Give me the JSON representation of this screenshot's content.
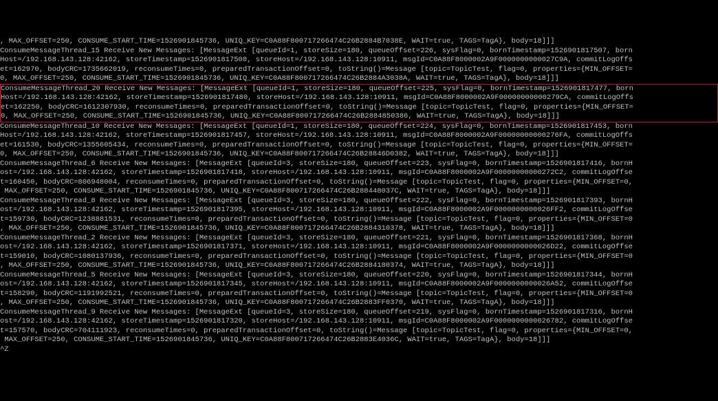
{
  "lines": {
    "l0": ", MAX_OFFSET=250, CONSUME_START_TIME=1526901845736, UNIQ_KEY=C0A88F800717266474C26B2884B7038E, WAIT=true, TAGS=TagA}, body=18]]]",
    "l1": "ConsumeMessageThread_15 Receive New Messages: [MessageExt [queueId=1, storeSize=180, queueOffset=226, sysFlag=0, bornTimestamp=1526901817507, born",
    "l2": "Host=/192.168.143.128:42162, storeTimestamp=1526901817508, storeHost=/192.168.143.128:10911, msgId=C0A88F8000002A9F0000000000027C9A, commitLogOffs",
    "l3": "et=162970, bodyCRC=1735662019, reconsumeTimes=0, preparedTransactionOffset=0, toString()=Message [topic=TopicTest, flag=0, properties={MIN_OFFSET=",
    "l4": "0, MAX_OFFSET=250, CONSUME_START_TIME=1526901845736, UNIQ_KEY=C0A88F800717266474C26B2884A3038A, WAIT=true, TAGS=TagA}, body=18]]]",
    "l5": "ConsumeMessageThread_20 Receive New Messages: [MessageExt [queueId=1, storeSize=180, queueOffset=225, sysFlag=0, bornTimestamp=1526901817477, born",
    "l6": "Host=/192.168.143.128:42162, storeTimestamp=1526901817480, storeHost=/192.168.143.128:10911, msgId=C0A88F8000002A9F00000000000279CA, commitLogOffs",
    "l7": "et=162250, bodyCRC=1612307930, reconsumeTimes=0, preparedTransactionOffset=0, toString()=Message [topic=TopicTest, flag=0, properties={MIN_OFFSET=",
    "l8": "0, MAX_OFFSET=250, CONSUME_START_TIME=1526901845736, UNIQ_KEY=C0A88F800717266474C26B2884850386, WAIT=true, TAGS=TagA}, body=18]]]",
    "l9": "ConsumeMessageThread_10 Receive New Messages: [MessageExt [queueId=1, storeSize=180, queueOffset=224, sysFlag=0, bornTimestamp=1526901817453, born",
    "l10": "Host=/192.168.143.128:42162, storeTimestamp=1526901817457, storeHost=/192.168.143.128:10911, msgId=C0A88F8000002A9F00000000000276FA, commitLogOffs",
    "l11": "et=161530, bodyCRC=1355605434, reconsumeTimes=0, preparedTransactionOffset=0, toString()=Message [topic=TopicTest, flag=0, properties={MIN_OFFSET=",
    "l12": "0, MAX_OFFSET=250, CONSUME_START_TIME=1526901845736, UNIQ_KEY=C0A88F800717266474C26B28846D0382, WAIT=true, TAGS=TagA}, body=18]]]",
    "l13": "ConsumeMessageThread_6 Receive New Messages: [MessageExt [queueId=3, storeSize=180, queueOffset=223, sysFlag=0, bornTimestamp=1526901817416, bornH",
    "l14": "ost=/192.168.143.128:42162, storeTimestamp=1526901817418, storeHost=/192.168.143.128:10911, msgId=C0A88F8000002A9F00000000000272C2, commitLogOffse",
    "l15": "t=160450, bodyCRC=806948004, reconsumeTimes=0, preparedTransactionOffset=0, toString()=Message [topic=TopicTest, flag=0, properties={MIN_OFFSET=0,",
    "l16": " MAX_OFFSET=250, CONSUME_START_TIME=1526901845736, UNIQ_KEY=C0A88F800717266474C26B288448037C, WAIT=true, TAGS=TagA}, body=18]]]",
    "l17": "ConsumeMessageThread_8 Receive New Messages: [MessageExt [queueId=3, storeSize=180, queueOffset=222, sysFlag=0, bornTimestamp=1526901817393, bornH",
    "l18": "ost=/192.168.143.128:42162, storeTimestamp=1526901817395, storeHost=/192.168.143.128:10911, msgId=C0A88F8000002A9F0000000000026FF2, commitLogOffse",
    "l19": "t=159730, bodyCRC=1238881531, reconsumeTimes=0, preparedTransactionOffset=0, toString()=Message [topic=TopicTest, flag=0, properties={MIN_OFFSET=0",
    "l20": ", MAX_OFFSET=250, CONSUME_START_TIME=1526901845736, UNIQ_KEY=C0A88F800717266474C26B2884310378, WAIT=true, TAGS=TagA}, body=18]]]",
    "l21": "ConsumeMessageThread_2 Receive New Messages: [MessageExt [queueId=3, storeSize=180, queueOffset=221, sysFlag=0, bornTimestamp=1526901817368, bornH",
    "l22": "ost=/192.168.143.128:42162, storeTimestamp=1526901817371, storeHost=/192.168.143.128:10911, msgId=C0A88F8000002A9F0000000000026D22, commitLogOffse",
    "l23": "t=159010, bodyCRC=1080137936, reconsumeTimes=0, preparedTransactionOffset=0, toString()=Message [topic=TopicTest, flag=0, properties={MIN_OFFSET=0",
    "l24": ", MAX_OFFSET=250, CONSUME_START_TIME=1526901845736, UNIQ_KEY=C0A88F800717266474C26B2884180374, WAIT=true, TAGS=TagA}, body=18]]]",
    "l25": "ConsumeMessageThread_5 Receive New Messages: [MessageExt [queueId=3, storeSize=180, queueOffset=220, sysFlag=0, bornTimestamp=1526901817344, bornH",
    "l26": "ost=/192.168.143.128:42162, storeTimestamp=1526901817345, storeHost=/192.168.143.128:10911, msgId=C0A88F8000002A9F0000000000026A52, commitLogOffse",
    "l27": "t=158290, bodyCRC=1191992521, reconsumeTimes=0, preparedTransactionOffset=0, toString()=Message [topic=TopicTest, flag=0, properties={MIN_OFFSET=0",
    "l28": ", MAX_OFFSET=250, CONSUME_START_TIME=1526901845736, UNIQ_KEY=C0A88F800717266474C26B2883FF0370, WAIT=true, TAGS=TagA}, body=18]]]",
    "l29": "ConsumeMessageThread_9 Receive New Messages: [MessageExt [queueId=3, storeSize=180, queueOffset=219, sysFlag=0, bornTimestamp=1526901817316, bornH",
    "l30": "ost=/192.168.143.128:42162, storeTimestamp=1526901817320, storeHost=/192.168.143.128:10911, msgId=C0A88F8000002A9F0000000000026782, commitLogOffse",
    "l31": "t=157570, bodyCRC=704111923, reconsumeTimes=0, preparedTransactionOffset=0, toString()=Message [topic=TopicTest, flag=0, properties={MIN_OFFSET=0,",
    "l32": " MAX_OFFSET=250, CONSUME_START_TIME=1526901845736, UNIQ_KEY=C0A88F800717266474C26B2883E4036C, WAIT=true, TAGS=TagA}, body=18]]]",
    "l33": "^Z"
  }
}
